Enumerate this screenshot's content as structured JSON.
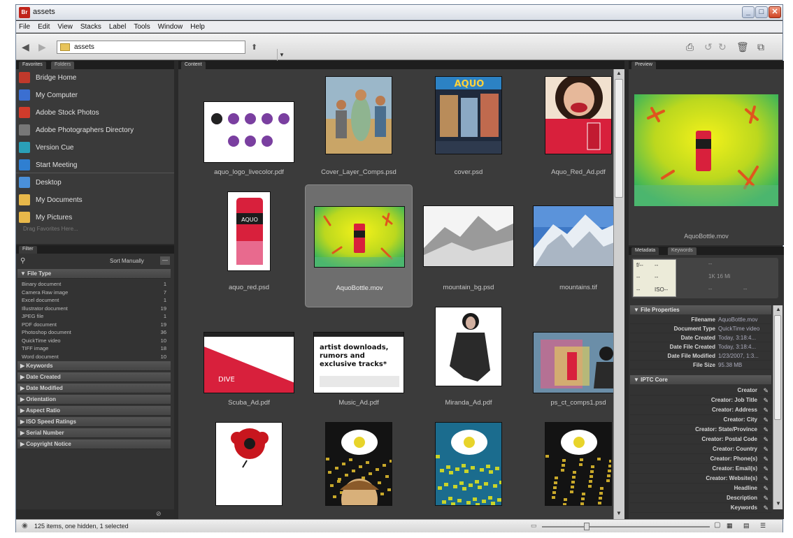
{
  "window": {
    "title": "assets",
    "app_icon_label": "Br"
  },
  "menu": [
    "File",
    "Edit",
    "View",
    "Stacks",
    "Label",
    "Tools",
    "Window",
    "Help"
  ],
  "toolbar": {
    "path": "assets"
  },
  "panels": {
    "favorites_tab": "Favorites",
    "folders_tab": "Folders",
    "filter_tab": "Filter",
    "content_tab": "Content",
    "preview_tab": "Preview",
    "metadata_tab": "Metadata",
    "keywords_tab": "Keywords"
  },
  "favorites": [
    {
      "label": "Bridge Home",
      "icon": "bridge-home-icon",
      "color": "#c0392b"
    },
    {
      "label": "My Computer",
      "icon": "computer-icon",
      "color": "#3b6fd1"
    },
    {
      "label": "Adobe Stock Photos",
      "icon": "stock-photos-icon",
      "color": "#d13b2b"
    },
    {
      "label": "Adobe Photographers Directory",
      "icon": "photographers-icon",
      "color": "#777777"
    },
    {
      "label": "Version Cue",
      "icon": "version-cue-icon",
      "color": "#2aa0b8"
    },
    {
      "label": "Start Meeting",
      "icon": "meeting-icon",
      "color": "#2f7fd1"
    }
  ],
  "favorites2": [
    {
      "label": "Desktop",
      "icon": "desktop-icon",
      "color": "#4a90d9"
    },
    {
      "label": "My Documents",
      "icon": "documents-folder-icon",
      "color": "#e8b84a"
    },
    {
      "label": "My Pictures",
      "icon": "pictures-folder-icon",
      "color": "#e8b84a"
    }
  ],
  "favorites_hint": "Drag Favorites Here...",
  "filter": {
    "sort": "Sort Manually",
    "file_type_header": "File Type",
    "file_types": [
      {
        "name": "Binary document",
        "count": "1"
      },
      {
        "name": "Camera Raw image",
        "count": "7"
      },
      {
        "name": "Excel document",
        "count": "1"
      },
      {
        "name": "Illustrator document",
        "count": "19"
      },
      {
        "name": "JPEG file",
        "count": "1"
      },
      {
        "name": "PDF document",
        "count": "19"
      },
      {
        "name": "Photoshop document",
        "count": "36"
      },
      {
        "name": "QuickTime video",
        "count": "10"
      },
      {
        "name": "TIFF image",
        "count": "18"
      },
      {
        "name": "Word document",
        "count": "10"
      }
    ],
    "categories": [
      "Keywords",
      "Date Created",
      "Date Modified",
      "Orientation",
      "Aspect Ratio",
      "ISO Speed Ratings",
      "Serial Number",
      "Copyright Notice"
    ]
  },
  "content_items": [
    {
      "name": "aquo_logo_livecolor.pdf"
    },
    {
      "name": "Cover_Layer_Comps.psd"
    },
    {
      "name": "cover.psd"
    },
    {
      "name": "Aquo_Red_Ad.pdf"
    },
    {
      "name": "aquo_red.psd"
    },
    {
      "name": "AquoBottle.mov"
    },
    {
      "name": "mountain_bg.psd"
    },
    {
      "name": "mountains.tif"
    },
    {
      "name": "Scuba_Ad.pdf"
    },
    {
      "name": "Music_Ad.pdf"
    },
    {
      "name": "Miranda_Ad.pdf"
    },
    {
      "name": "ps_ct_comps1.psd"
    },
    {
      "name": ""
    },
    {
      "name": ""
    },
    {
      "name": ""
    },
    {
      "name": ""
    }
  ],
  "thumb_text": {
    "cover_logo": "AQUO",
    "can_label": "AQUO",
    "scuba_label": "DIVE",
    "music_headline": "artist downloads, rumors and exclusive tracks*"
  },
  "preview": {
    "filename": "AquoBottle.mov"
  },
  "metadata": {
    "thumb_labels": [
      "f/--",
      "--",
      "--",
      "--",
      "--",
      "ISO--"
    ],
    "thumb_right": [
      "--",
      "1K 16 Mi",
      "--",
      "--"
    ],
    "file_properties_header": "File Properties",
    "file_properties": [
      {
        "k": "Filename",
        "v": "AquoBottle.mov"
      },
      {
        "k": "Document Type",
        "v": "QuickTime video"
      },
      {
        "k": "Date Created",
        "v": "Today, 3:18:4..."
      },
      {
        "k": "Date File Created",
        "v": "Today, 3:18:4..."
      },
      {
        "k": "Date File Modified",
        "v": "1/23/2007, 1:3..."
      },
      {
        "k": "File Size",
        "v": "95.38 MB"
      }
    ],
    "iptc_header": "IPTC Core",
    "iptc": [
      "Creator",
      "Creator: Job Title",
      "Creator: Address",
      "Creator: City",
      "Creator: State/Province",
      "Creator: Postal Code",
      "Creator: Country",
      "Creator: Phone(s)",
      "Creator: Email(s)",
      "Creator: Website(s)",
      "Headline",
      "Description",
      "Keywords"
    ]
  },
  "status": {
    "text": "125 items, one hidden, 1 selected"
  }
}
